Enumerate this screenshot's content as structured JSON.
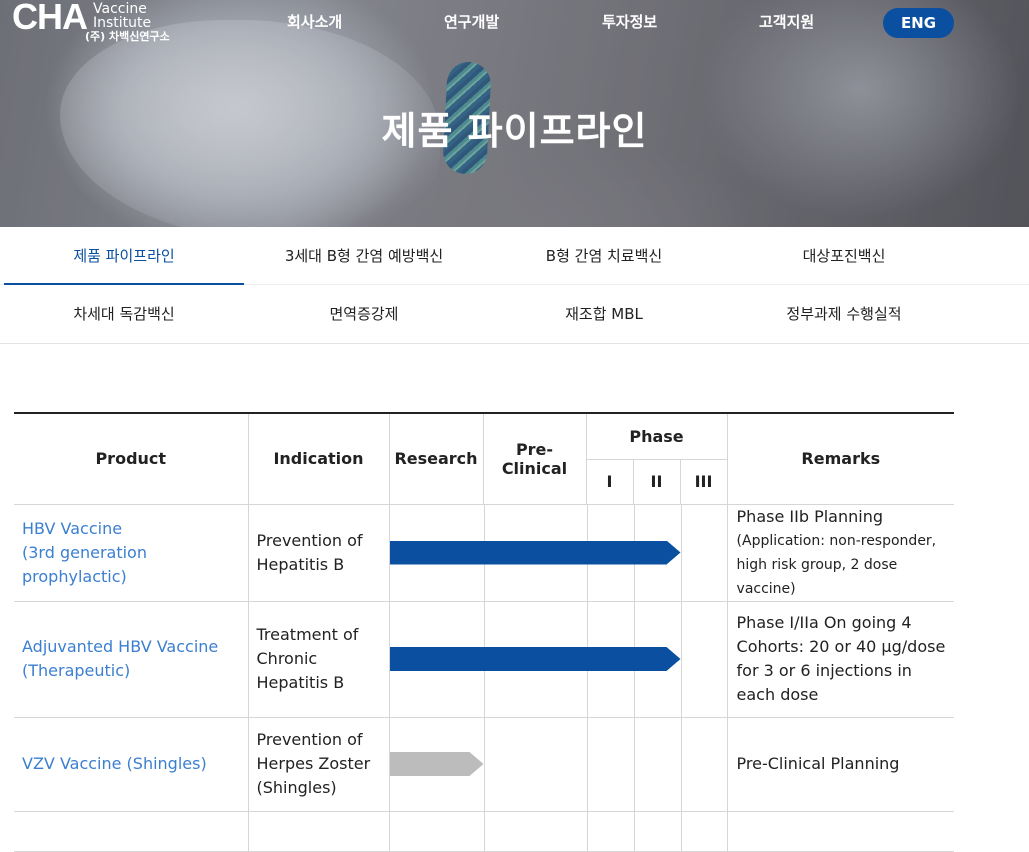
{
  "header": {
    "logo": {
      "mark": "CHA",
      "line1": "Vaccine",
      "line2": "Institute",
      "korean": "(주) 차백신연구소"
    },
    "nav": [
      "회사소개",
      "연구개발",
      "투자정보",
      "고객지원"
    ],
    "lang_button": "ENG"
  },
  "hero": {
    "title": "제품 파이프라인"
  },
  "subnav": {
    "row1": [
      "제품 파이프라인",
      "3세대 B형 간염 예방백신",
      "B형 간염 치료백신",
      "대상포진백신"
    ],
    "row2": [
      "차세대 독감백신",
      "면역증강제",
      "재조합 MBL",
      "정부과제 수행실적"
    ],
    "active": "제품 파이프라인"
  },
  "table": {
    "headers": {
      "product": "Product",
      "indication": "Indication",
      "research": "Research",
      "preclinical": "Pre-Clinical",
      "phase": "Phase",
      "phase_i": "I",
      "phase_ii": "II",
      "phase_iii": "III",
      "remarks": "Remarks"
    },
    "stage_order": [
      "Research",
      "Pre-Clinical",
      "Phase I",
      "Phase II",
      "Phase III"
    ],
    "rows": [
      {
        "product": [
          "HBV Vaccine",
          "(3rd generation",
          "prophylactic)"
        ],
        "indication": [
          "Prevention of",
          "Hepatitis B"
        ],
        "progress_through": "Phase II",
        "bar_color": "#0b4fa1",
        "remarks_main": "Phase IIb Planning",
        "remarks_sub": [
          "(Application: non-responder,",
          "high risk group, 2 dose vaccine)"
        ]
      },
      {
        "product": [
          "Adjuvanted HBV Vaccine",
          "(Therapeutic)"
        ],
        "indication": [
          "Treatment of",
          "Chronic",
          "Hepatitis B"
        ],
        "progress_through": "Phase II",
        "bar_color": "#0b4fa1",
        "remarks_main": "Phase I/IIa On going 4 Cohorts: 20 or 40 μg/dose for 3 or 6 injections in each dose",
        "remarks_sub": []
      },
      {
        "product": [
          "VZV Vaccine (Shingles)"
        ],
        "indication": [
          "Prevention of",
          "Herpes Zoster",
          "(Shingles)"
        ],
        "progress_through": "Research",
        "bar_color": "#bcbcbc",
        "remarks_main": "Pre-Clinical Planning",
        "remarks_sub": []
      }
    ]
  }
}
